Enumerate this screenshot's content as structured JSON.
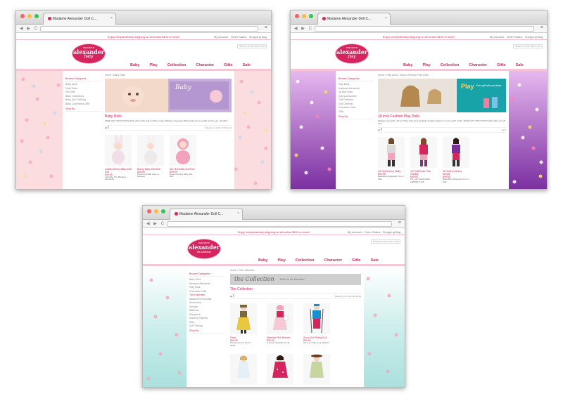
{
  "browser": {
    "tab_title": "Madame Alexander Doll C...",
    "tab_close": "×",
    "nav_buttons": "◀ ▶ C",
    "menu_icon": "≡"
  },
  "site": {
    "promo": "Enjoy complimentary shipping on all orders $100 or more!",
    "my_account": "My Account",
    "order_status": "Order Status",
    "shopping_bag": "Shopping Bag",
    "search_placeholder": "Search entire store here",
    "logo_top": "madame",
    "logo_main": "alexander",
    "nav": [
      "Baby",
      "Play",
      "Collection",
      "Character",
      "Gifts",
      "Sale"
    ]
  },
  "window_baby": {
    "logo_sub": "baby",
    "crumb": "Home / Baby Dolls",
    "sidebar_head": "Browse Categories",
    "sidebar_items": [
      "Baby Dolls",
      "Cloth Dolls",
      "Gift Sets",
      "Baby Collections",
      "Baby Doll Clothing",
      "Baby Collections Gifts"
    ],
    "shop_by": "Shop By",
    "banner_title": "Baby",
    "page_title": "Baby Dolls",
    "description": "FREE GIFT WITH PURCHASE with a baby doll purchase today. Madame Alexander Baby Dolls are as cuddly as they are adorable!",
    "pager": "Showing 1 to 12 of 72 Items",
    "products": [
      {
        "name": "Lullaby Bunny Baby Doll Doll",
        "price": "$49.95",
        "desc": "Adorable The Madame Alexander"
      },
      {
        "name": "Bunny Baby Doll Doll",
        "price": "$49.95",
        "desc": "Perfect for little ones or beloved"
      },
      {
        "name": "My First Baby Doll Doll",
        "price": "$49.95",
        "desc": "Good morning baby doll. Soft"
      }
    ]
  },
  "window_play": {
    "logo_sub": "play",
    "crumb": "Home / Play Dolls / 18 inch Fashion Play Dolls",
    "sidebar_head": "Browse Categories",
    "sidebar_items": [
      "Play Dolls",
      "Madame Alexander",
      "18 inch Dolls",
      "Doll Accessories",
      "Doll Furniture",
      "Doll Clothing",
      "Character Dolls",
      "Gifts"
    ],
    "shop_by": "Shop By",
    "banner_title": "Play",
    "banner_sub": "Free gift with purchase",
    "page_title": "18 inch Fashion Play Dolls",
    "description": "Madame Alexander 18 inch Play dolls are beautifully designed with fun mix & match outfits. FREE GIFT WITH PURCHASE with your 18\" doll.",
    "pager": "1 2 3",
    "products": [
      {
        "name": "18\" Doll Fancy Fluffy",
        "price": "$99.95",
        "desc": "Beautifully designed. Fun in that!"
      },
      {
        "name": "18\" Doll Rose Pink Holiday",
        "price": "$99.95",
        "desc": "For your Fashionable HERSELF doll!"
      },
      {
        "name": "18\" Doll Cool and Simple",
        "price": "$99.95",
        "desc": "Beautifully designed. Fun in that!"
      }
    ]
  },
  "window_collection": {
    "logo_sub": "the collection",
    "crumb": "Home / The Collection",
    "sidebar_head": "Browse Categories",
    "sidebar_items": [
      "Baby Dolls",
      "Madame Alexander",
      "Play Dolls",
      "Character Dolls",
      "The Collection",
      "Madame's Favorites",
      "Americana",
      "Fashion",
      "Ballerina",
      "Storybook",
      "Nursery Rhymes",
      "Gifts",
      "Doll Trading"
    ],
    "shop_by": "Shop By",
    "banner_title": "the Collection",
    "banner_quote": "\"Dolls for the Beholder\"",
    "page_title": "The Collection",
    "pager": "Showing 1 to 12 of 94 Items",
    "products": [
      {
        "name": "Flash",
        "price": "$99.95",
        "desc": "She knows just how to dash!"
      },
      {
        "name": "Meadow Pink Bonnet",
        "price": "$99.95",
        "desc": "A sweet keepsake for all"
      },
      {
        "name": "Snow Doll Skiing Doll",
        "price": "$99.95",
        "desc": "Are you ready to go skiing?"
      },
      {
        "name": "",
        "price": "",
        "desc": ""
      },
      {
        "name": "",
        "price": "",
        "desc": ""
      },
      {
        "name": "",
        "price": "",
        "desc": ""
      }
    ]
  },
  "colors": {
    "brand_pink": "#d6245f",
    "baby_bg": "#fbdde0",
    "play_bg": "#8e3aa8",
    "collection_bg": "#bfe8e6"
  }
}
